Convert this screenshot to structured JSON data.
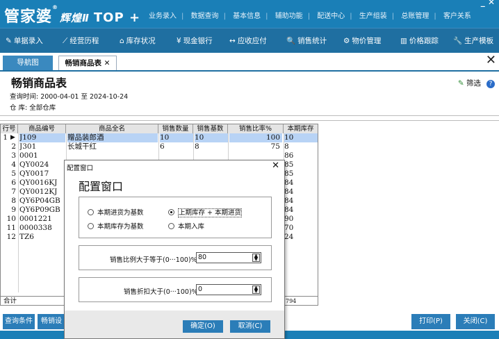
{
  "app": {
    "logo": "管家婆",
    "logo_sub": "辉煌Ⅱ",
    "logo_edition": "TOP +",
    "registered": "®",
    "window_controls": "_ ✕",
    "top_menu": [
      "业务录入",
      "数据查询",
      "基本信息",
      "辅助功能",
      "配送中心",
      "生产组装",
      "总账管理",
      "客户关系"
    ]
  },
  "toolbar": [
    {
      "icon": "✎",
      "label": "单据录入"
    },
    {
      "icon": "⟋",
      "label": "经营历程"
    },
    {
      "icon": "⌂",
      "label": "库存状况"
    },
    {
      "icon": "¥",
      "label": "现金银行"
    },
    {
      "icon": "↔",
      "label": "应收应付"
    },
    {
      "icon": "🔍",
      "label": "销售统计"
    },
    {
      "icon": "⚙",
      "label": "物价管理"
    },
    {
      "icon": "▥",
      "label": "价格跟踪"
    },
    {
      "icon": "🔧",
      "label": "生产模板"
    }
  ],
  "tabs": {
    "nav": "导航图",
    "active": "畅销商品表",
    "tab_close": "✕",
    "close_all": "✕"
  },
  "page": {
    "title": "畅销商品表",
    "query_time": "查询时间: 2000-04-01 至 2024-10-24",
    "warehouse": "仓    库: 全部仓库",
    "filter": "筛选",
    "help": "?"
  },
  "grid": {
    "columns": [
      "行号",
      "商品编号",
      "商品全名",
      "销售数量",
      "销售基数",
      "销售比率%",
      "本期库存"
    ],
    "rows": [
      {
        "no": "1",
        "code": "J109",
        "name": "赠品装郎酒",
        "qty": "10",
        "base": "10",
        "ratio": "100",
        "stock": "10"
      },
      {
        "no": "2",
        "code": "J301",
        "name": "长城干红",
        "qty": "6",
        "base": "8",
        "ratio": "75",
        "stock": "8"
      },
      {
        "no": "3",
        "code": "0001",
        "name": "",
        "qty": "",
        "base": "",
        "ratio": "",
        "stock": "86"
      },
      {
        "no": "4",
        "code": "QY0024",
        "name": "",
        "qty": "",
        "base": "",
        "ratio": "",
        "stock": "85"
      },
      {
        "no": "5",
        "code": "QY0017",
        "name": "",
        "qty": "",
        "base": "",
        "ratio": "",
        "stock": "85"
      },
      {
        "no": "6",
        "code": "QY0016KJ",
        "name": "",
        "qty": "",
        "base": "",
        "ratio": "",
        "stock": "84"
      },
      {
        "no": "7",
        "code": "QY0012KJ",
        "name": "",
        "qty": "",
        "base": "",
        "ratio": "",
        "stock": "84"
      },
      {
        "no": "8",
        "code": "QY6P04GB",
        "name": "",
        "qty": "",
        "base": "",
        "ratio": "",
        "stock": "84"
      },
      {
        "no": "9",
        "code": "QY6P09GB",
        "name": "",
        "qty": "",
        "base": "",
        "ratio": "",
        "stock": "84"
      },
      {
        "no": "10",
        "code": "0001221",
        "name": "",
        "qty": "",
        "base": "",
        "ratio": "",
        "stock": "90"
      },
      {
        "no": "11",
        "code": "0000338",
        "name": "",
        "qty": "",
        "base": "",
        "ratio": "",
        "stock": "70"
      },
      {
        "no": "12",
        "code": "TZ6",
        "name": "",
        "qty": "",
        "base": "",
        "ratio": "",
        "stock": "24"
      }
    ],
    "total_label": "合计",
    "total_stock": "794"
  },
  "bottom": {
    "query": "查询条件",
    "settings": "畅销设",
    "print": "打印(P)",
    "close": "关闭(C)"
  },
  "dialog": {
    "title": "配置窗口",
    "close": "✕",
    "heading": "配置窗口",
    "options": [
      {
        "label": "本期进货为基数",
        "selected": false
      },
      {
        "label": "上期库存 + 本期进货",
        "selected": true
      },
      {
        "label": "本期库存为基数",
        "selected": false
      },
      {
        "label": "本期入库",
        "selected": false
      }
    ],
    "ratio_label": "销售比例大于等于(0···100)%",
    "ratio_value": "80",
    "discount_label": "销售折扣大于(0···100)%",
    "discount_value": "0",
    "ok": "确定(O)",
    "cancel": "取消(C)"
  }
}
